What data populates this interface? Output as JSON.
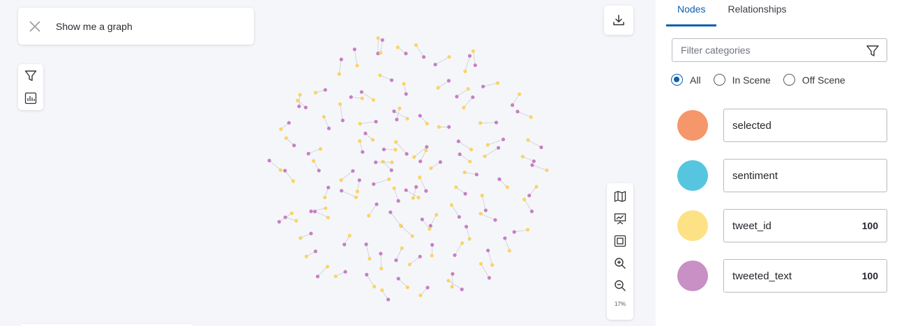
{
  "search": {
    "query": "Show me a graph"
  },
  "icons": {
    "close": "close-icon",
    "filter": "filter-icon",
    "stats": "bar-chart-icon",
    "download": "download-icon",
    "map": "map-icon",
    "presentation": "presentation-icon",
    "fit": "fit-screen-icon",
    "zoom_in": "zoom-in-icon",
    "zoom_out": "zoom-out-icon"
  },
  "zoom": {
    "level": "17%"
  },
  "panel": {
    "tabs": [
      {
        "label": "Nodes",
        "active": true
      },
      {
        "label": "Relationships",
        "active": false
      }
    ],
    "filter_placeholder": "Filter categories",
    "radio_options": [
      {
        "label": "All",
        "checked": true
      },
      {
        "label": "In Scene",
        "checked": false
      },
      {
        "label": "Off Scene",
        "checked": false
      }
    ],
    "categories": [
      {
        "name": "selected",
        "color": "#f5976a",
        "count": ""
      },
      {
        "name": "sentiment",
        "color": "#56c6e0",
        "count": ""
      },
      {
        "name": "tweet_id",
        "color": "#fde185",
        "count": "100"
      },
      {
        "name": "tweeted_text",
        "color": "#c890c4",
        "count": "100"
      }
    ]
  },
  "graph": {
    "node_colors": {
      "tweet_id": "#fad466",
      "tweeted_text": "#c67fc3"
    },
    "edge_color": "#a9a9b3",
    "pair_count": 100
  }
}
